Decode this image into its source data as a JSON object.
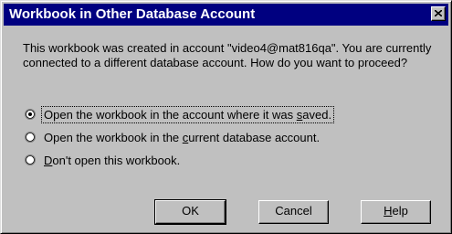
{
  "window": {
    "title": "Workbook in Other Database Account",
    "close_icon": "close-icon"
  },
  "message": "This workbook was created in account \"video4@mat816qa\". You are currently connected to a different database account. How do you want to proceed?",
  "options": [
    {
      "label_before": "Open the workbook in the account where it was ",
      "mnemonic": "s",
      "label_after": "aved.",
      "selected": true
    },
    {
      "label_before": "Open the workbook in the ",
      "mnemonic": "c",
      "label_after": "urrent database account.",
      "selected": false
    },
    {
      "label_before": "",
      "mnemonic": "D",
      "label_after": "on't open this workbook.",
      "selected": false
    }
  ],
  "buttons": {
    "ok": "OK",
    "cancel": "Cancel",
    "help_mnemonic": "H",
    "help_rest": "elp"
  }
}
